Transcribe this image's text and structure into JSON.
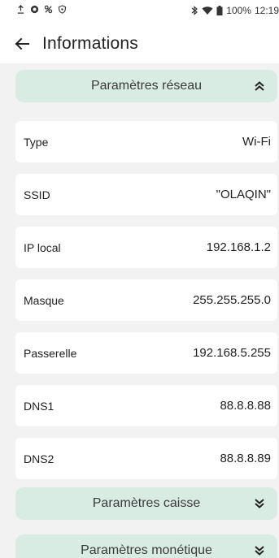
{
  "status_bar": {
    "icons_left": [
      "upload-icon",
      "sync-icon",
      "link-icon",
      "shield-icon"
    ],
    "icons_right": [
      "bluetooth-icon",
      "wifi-icon",
      "battery-icon"
    ],
    "battery": "100%",
    "time": "12:19"
  },
  "app_bar": {
    "back_icon": "arrow-left-icon",
    "title": "Informations"
  },
  "sections": {
    "network": {
      "label": "Paramètres réseau",
      "expanded": true
    },
    "register": {
      "label": "Paramètres caisse",
      "expanded": false
    },
    "payment": {
      "label": "Paramètres monétique",
      "expanded": false
    }
  },
  "network_rows": [
    {
      "key": "Type",
      "value": "Wi-Fi"
    },
    {
      "key": "SSID",
      "value": "\"OLAQIN\""
    },
    {
      "key": "IP local",
      "value": "192.168.1.2"
    },
    {
      "key": "Masque",
      "value": "255.255.255.0"
    },
    {
      "key": "Passerelle",
      "value": "192.168.5.255"
    },
    {
      "key": "DNS1",
      "value": "88.8.8.88"
    },
    {
      "key": "DNS2",
      "value": "88.8.8.89"
    }
  ],
  "colors": {
    "section_header_bg": "#d9ece4",
    "page_bg": "#f2f2f2",
    "card_bg": "#ffffff"
  }
}
